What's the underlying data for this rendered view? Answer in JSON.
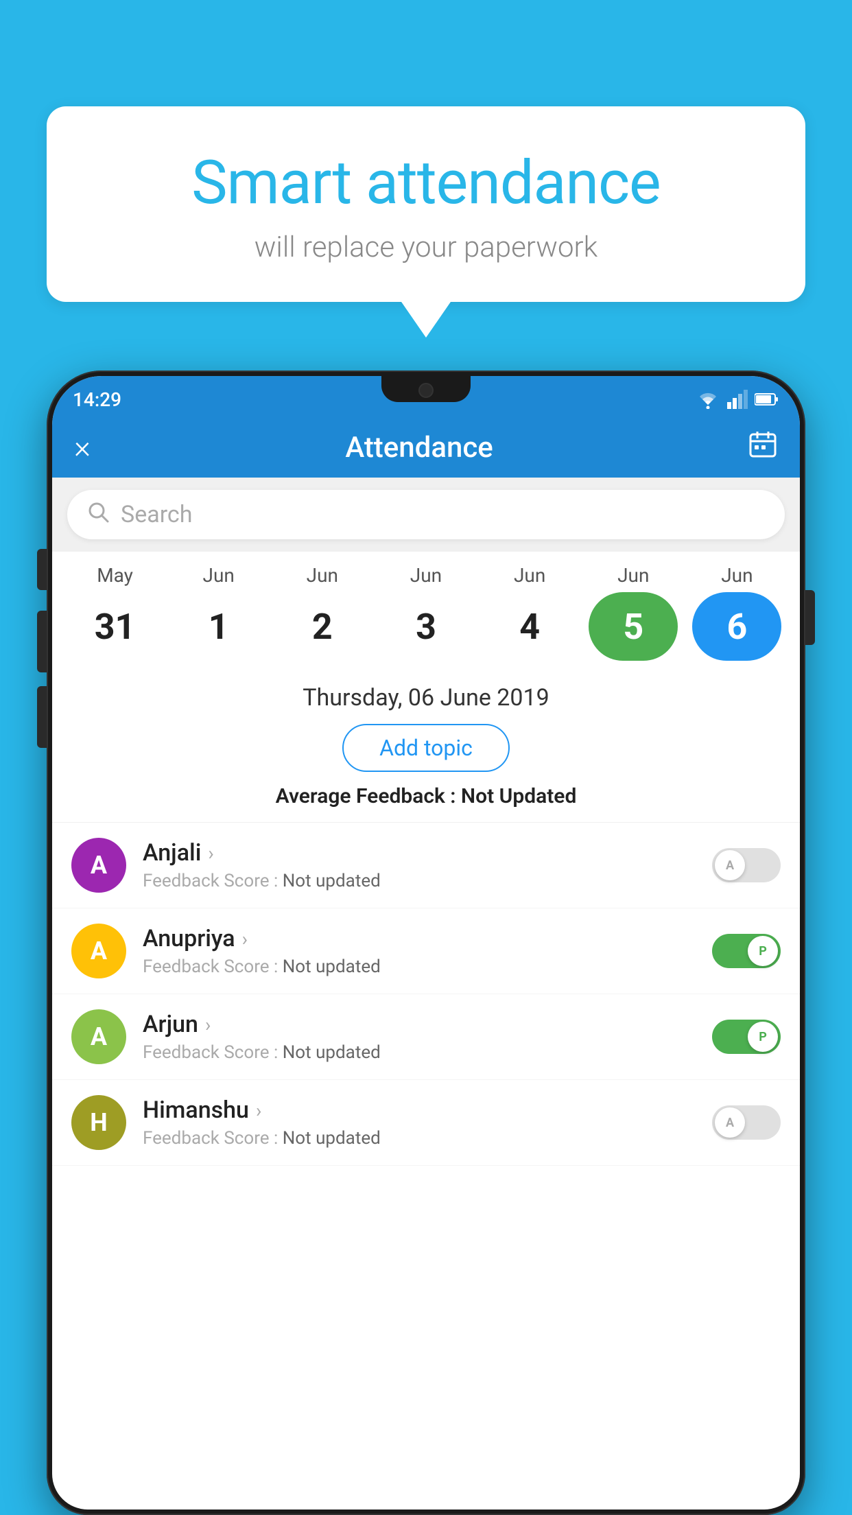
{
  "background_color": "#29b6e8",
  "speech_bubble": {
    "title": "Smart attendance",
    "subtitle": "will replace your paperwork"
  },
  "status_bar": {
    "time": "14:29",
    "icons": [
      "wifi",
      "signal",
      "battery"
    ]
  },
  "header": {
    "title": "Attendance",
    "close_label": "×",
    "calendar_icon": "📅"
  },
  "search": {
    "placeholder": "Search"
  },
  "calendar": {
    "months": [
      "May",
      "Jun",
      "Jun",
      "Jun",
      "Jun",
      "Jun",
      "Jun"
    ],
    "dates": [
      "31",
      "1",
      "2",
      "3",
      "4",
      "5",
      "6"
    ],
    "selected_green_index": 5,
    "selected_blue_index": 6
  },
  "date_info": {
    "selected_date": "Thursday, 06 June 2019",
    "add_topic_label": "Add topic",
    "feedback_label": "Average Feedback :",
    "feedback_value": "Not Updated"
  },
  "students": [
    {
      "name": "Anjali",
      "initial": "A",
      "avatar_color": "purple",
      "feedback_label": "Feedback Score :",
      "feedback_value": "Not updated",
      "toggle_state": "off",
      "toggle_letter": "A"
    },
    {
      "name": "Anupriya",
      "initial": "A",
      "avatar_color": "yellow",
      "feedback_label": "Feedback Score :",
      "feedback_value": "Not updated",
      "toggle_state": "on",
      "toggle_letter": "P"
    },
    {
      "name": "Arjun",
      "initial": "A",
      "avatar_color": "green",
      "feedback_label": "Feedback Score :",
      "feedback_value": "Not updated",
      "toggle_state": "on",
      "toggle_letter": "P"
    },
    {
      "name": "Himanshu",
      "initial": "H",
      "avatar_color": "olive",
      "feedback_label": "Feedback Score :",
      "feedback_value": "Not updated",
      "toggle_state": "off",
      "toggle_letter": "A"
    }
  ]
}
